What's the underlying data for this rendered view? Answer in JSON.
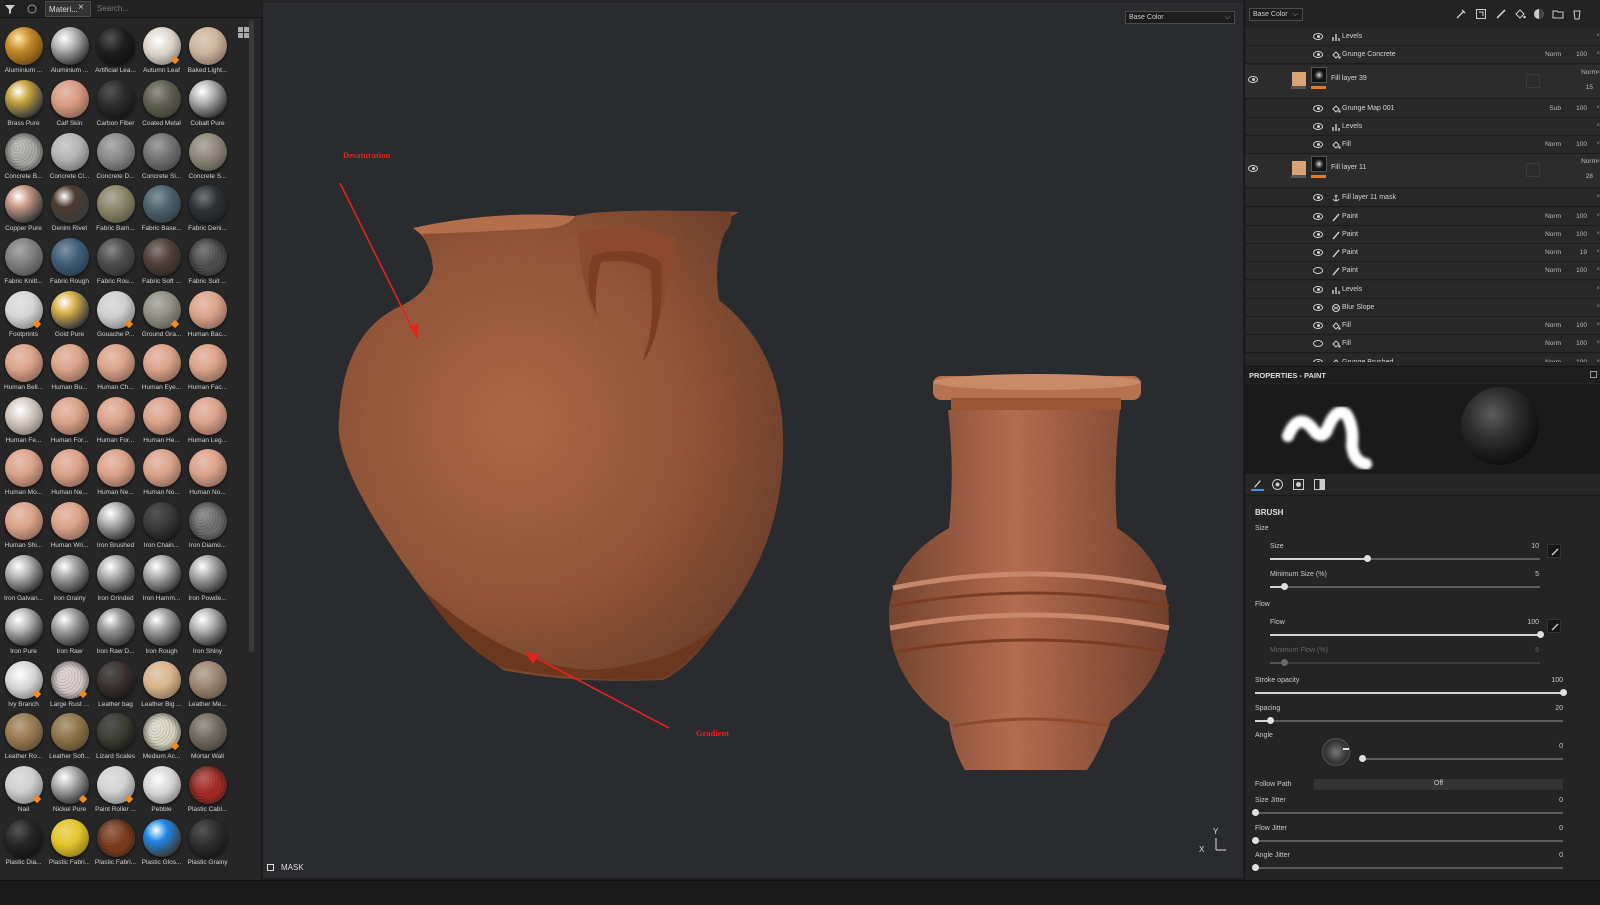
{
  "shelf": {
    "tab_label": "Materi...",
    "search_placeholder": "Search...",
    "materials": [
      {
        "label": "Aluminium ...",
        "color": "#c58a2a",
        "style": "dots"
      },
      {
        "label": "Aluminium ...",
        "color": "#b8b8b8",
        "style": "metal"
      },
      {
        "label": "Artificial Lea...",
        "color": "#1e1e1e",
        "style": "dark"
      },
      {
        "label": "Autumn Leaf",
        "color": "#d8cfc4",
        "style": "leaf",
        "badge": true
      },
      {
        "label": "Baked Light...",
        "color": "#cdb59c",
        "style": "matte"
      },
      {
        "label": "Brass Pure",
        "color": "#c9a53e",
        "style": "metal"
      },
      {
        "label": "Calf Skin",
        "color": "#d79a83",
        "style": "matte"
      },
      {
        "label": "Carbon Fiber",
        "color": "#2c2c2c",
        "style": "dark"
      },
      {
        "label": "Coated Metal",
        "color": "#5f5f4e",
        "style": "matte"
      },
      {
        "label": "Cobalt Pure",
        "color": "#b7b7b7",
        "style": "metal"
      },
      {
        "label": "Concrete B...",
        "color": "#a9a9a5",
        "style": "rough"
      },
      {
        "label": "Concrete Cl...",
        "color": "#b5b5b5",
        "style": "matte"
      },
      {
        "label": "Concrete D...",
        "color": "#8b8b8b",
        "style": "matte"
      },
      {
        "label": "Concrete Si...",
        "color": "#737373",
        "style": "matte"
      },
      {
        "label": "Concrete S...",
        "color": "#8f8778",
        "style": "matte"
      },
      {
        "label": "Copper Pure",
        "color": "#c99a86",
        "style": "metal"
      },
      {
        "label": "Denim Rivet",
        "color": "#4d3c2e",
        "style": "metal"
      },
      {
        "label": "Fabric Bam...",
        "color": "#8a8568",
        "style": "matte"
      },
      {
        "label": "Fabric Base...",
        "color": "#4a606a",
        "style": "matte"
      },
      {
        "label": "Fabric Deni...",
        "color": "#2e3236",
        "style": "matte"
      },
      {
        "label": "Fabric Knitt...",
        "color": "#7f7f7f",
        "style": "matte"
      },
      {
        "label": "Fabric Rough",
        "color": "#3f5d78",
        "style": "matte"
      },
      {
        "label": "Fabric Rou...",
        "color": "#4d4d4d",
        "style": "matte"
      },
      {
        "label": "Fabric Soft ...",
        "color": "#4e3f39",
        "style": "matte"
      },
      {
        "label": "Fabric Suit ...",
        "color": "#4f4f4f",
        "style": "rough"
      },
      {
        "label": "Footprints",
        "color": "#d6d6d6",
        "style": "matte",
        "badge": true
      },
      {
        "label": "Gold Pure",
        "color": "#d9b24a",
        "style": "metal"
      },
      {
        "label": "Gouache P...",
        "color": "#cfcfcf",
        "style": "matte",
        "badge": true
      },
      {
        "label": "Ground Gra...",
        "color": "#8f8f84",
        "style": "matte",
        "badge": true
      },
      {
        "label": "Human Bac...",
        "color": "#dba28a",
        "style": "matte"
      },
      {
        "label": "Human Bell...",
        "color": "#dba28a",
        "style": "matte"
      },
      {
        "label": "Human Bu...",
        "color": "#dba28a",
        "style": "matte"
      },
      {
        "label": "Human Ch...",
        "color": "#dba28a",
        "style": "matte"
      },
      {
        "label": "Human Eye...",
        "color": "#dba28a",
        "style": "matte"
      },
      {
        "label": "Human Fac...",
        "color": "#dba28a",
        "style": "matte"
      },
      {
        "label": "Human Fe...",
        "color": "#c9bdb4",
        "style": "leaf"
      },
      {
        "label": "Human For...",
        "color": "#dba28a",
        "style": "matte"
      },
      {
        "label": "Human For...",
        "color": "#dba28a",
        "style": "matte"
      },
      {
        "label": "Human He...",
        "color": "#dba28a",
        "style": "matte"
      },
      {
        "label": "Human Leg...",
        "color": "#dba28a",
        "style": "matte"
      },
      {
        "label": "Human Mo...",
        "color": "#dba28a",
        "style": "matte"
      },
      {
        "label": "Human Ne...",
        "color": "#dba28a",
        "style": "matte"
      },
      {
        "label": "Human Ne...",
        "color": "#dba28a",
        "style": "matte"
      },
      {
        "label": "Human No...",
        "color": "#dba28a",
        "style": "matte"
      },
      {
        "label": "Human No...",
        "color": "#dba28a",
        "style": "matte"
      },
      {
        "label": "Human Shi...",
        "color": "#dba28a",
        "style": "matte"
      },
      {
        "label": "Human Wri...",
        "color": "#dba28a",
        "style": "matte"
      },
      {
        "label": "Iron Brushed",
        "color": "#b5b5b5",
        "style": "metal"
      },
      {
        "label": "Iron Chain...",
        "color": "#3a3a3a",
        "style": "dark"
      },
      {
        "label": "Iron Diamo...",
        "color": "#6f6f6f",
        "style": "rough"
      },
      {
        "label": "Iron Galvan...",
        "color": "#b9b9b9",
        "style": "metal"
      },
      {
        "label": "Iron Grainy",
        "color": "#a9a9a9",
        "style": "metal"
      },
      {
        "label": "Iron Grinded",
        "color": "#b3b3b3",
        "style": "metal"
      },
      {
        "label": "Iron Hamm...",
        "color": "#b3b3b3",
        "style": "metal"
      },
      {
        "label": "Iron Powde...",
        "color": "#aeaeae",
        "style": "metal"
      },
      {
        "label": "Iron Pure",
        "color": "#bdbdbd",
        "style": "metal"
      },
      {
        "label": "Iron Raw",
        "color": "#a7a7a7",
        "style": "metal"
      },
      {
        "label": "Iron Raw D...",
        "color": "#9c9c9c",
        "style": "metal"
      },
      {
        "label": "Iron Rough",
        "color": "#a8a8a8",
        "style": "metal"
      },
      {
        "label": "Iron Shiny",
        "color": "#b9b9b9",
        "style": "metal"
      },
      {
        "label": "Ivy Branch",
        "color": "#d2d2d2",
        "style": "leaf",
        "badge": true
      },
      {
        "label": "Large Rust ...",
        "color": "#d8c9c9",
        "style": "rough",
        "badge": true
      },
      {
        "label": "Leather bag",
        "color": "#3b3230",
        "style": "dark"
      },
      {
        "label": "Leather Big ...",
        "color": "#d8b48d",
        "style": "matte"
      },
      {
        "label": "Leather Me...",
        "color": "#9c8872",
        "style": "matte"
      },
      {
        "label": "Leather Ro...",
        "color": "#9a7a53",
        "style": "matte"
      },
      {
        "label": "Leather Soft...",
        "color": "#8e7449",
        "style": "matte"
      },
      {
        "label": "Lizard Scales",
        "color": "#3d3f35",
        "style": "dark"
      },
      {
        "label": "Medium Ac...",
        "color": "#d9d5c2",
        "style": "rough",
        "badge": true
      },
      {
        "label": "Mortar Wall",
        "color": "#736b5f",
        "style": "matte"
      },
      {
        "label": "Nail",
        "color": "#cfcfcf",
        "style": "matte",
        "badge": true
      },
      {
        "label": "Nickel Pure",
        "color": "#b3b3b3",
        "style": "metal",
        "badge": true
      },
      {
        "label": "Paint Roller ...",
        "color": "#d2d2d2",
        "style": "matte",
        "badge": true
      },
      {
        "label": "Pebble",
        "color": "#d1d1d1",
        "style": "leaf"
      },
      {
        "label": "Plastic Cabl...",
        "color": "#a62924",
        "style": "rough"
      },
      {
        "label": "Plastic Dia...",
        "color": "#262626",
        "style": "dark"
      },
      {
        "label": "Plastic Fabri...",
        "color": "#e3c42c",
        "style": "matte"
      },
      {
        "label": "Plastic Fabri...",
        "color": "#7e3c1c",
        "style": "rough"
      },
      {
        "label": "Plastic Glos...",
        "color": "#1f88e8",
        "style": "metal"
      },
      {
        "label": "Plastic Grainy",
        "color": "#303030",
        "style": "dark"
      }
    ]
  },
  "viewport": {
    "channel": "Base Color",
    "annotations": {
      "desaturation": "Desaturation",
      "gradient": "Gradient"
    },
    "mask_label": "MASK",
    "axis_y": "Y",
    "axis_x": "X",
    "accent": "#e3231d"
  },
  "layers": {
    "channel": "Base Color",
    "rows": [
      {
        "kind": "effect",
        "icon": "levels-icon",
        "name": "Levels",
        "blend": "",
        "opacity": "",
        "visible": true
      },
      {
        "kind": "effect",
        "icon": "fill-icon",
        "name": "Grunge Concrete",
        "blend": "Norm",
        "opacity": "100",
        "visible": true
      },
      {
        "kind": "layer",
        "name": "Fill layer 39",
        "blend": "Norm",
        "opacity": "15",
        "visible": true
      },
      {
        "kind": "effect",
        "icon": "fill-icon",
        "name": "Grunge Map 001",
        "blend": "Sub",
        "opacity": "100",
        "visible": true
      },
      {
        "kind": "effect",
        "icon": "levels-icon",
        "name": "Levels",
        "blend": "",
        "opacity": "",
        "visible": true
      },
      {
        "kind": "effect",
        "icon": "fill-icon",
        "name": "Fill",
        "blend": "Norm",
        "opacity": "100",
        "visible": true
      },
      {
        "kind": "layer",
        "name": "Fill layer 11",
        "blend": "Norm",
        "opacity": "28",
        "visible": true
      },
      {
        "kind": "effect",
        "icon": "anchor-icon",
        "name": "Fill layer 11 mask",
        "blend": "",
        "opacity": "",
        "visible": true
      },
      {
        "kind": "effect",
        "icon": "brush-icon",
        "name": "Paint",
        "blend": "Norm",
        "opacity": "100",
        "visible": true
      },
      {
        "kind": "effect",
        "icon": "brush-icon",
        "name": "Paint",
        "blend": "Norm",
        "opacity": "100",
        "visible": true
      },
      {
        "kind": "effect",
        "icon": "brush-icon",
        "name": "Paint",
        "blend": "Norm",
        "opacity": "19",
        "visible": true
      },
      {
        "kind": "effect",
        "icon": "brush-icon",
        "name": "Paint",
        "blend": "Norm",
        "opacity": "100",
        "visible": false
      },
      {
        "kind": "effect",
        "icon": "levels-icon",
        "name": "Levels",
        "blend": "",
        "opacity": "",
        "visible": true
      },
      {
        "kind": "effect",
        "icon": "blur-icon",
        "name": "Blur Slope",
        "blend": "",
        "opacity": "",
        "visible": true
      },
      {
        "kind": "effect",
        "icon": "fill-icon",
        "name": "Fill",
        "blend": "Norm",
        "opacity": "100",
        "visible": true
      },
      {
        "kind": "effect",
        "icon": "fill-icon",
        "name": "Fill",
        "blend": "Norm",
        "opacity": "100",
        "visible": false
      },
      {
        "kind": "effect",
        "icon": "fill-icon",
        "name": "Grunge Brushed",
        "blend": "Norm",
        "opacity": "100",
        "visible": true
      }
    ]
  },
  "properties": {
    "title": "PROPERTIES - PAINT",
    "section": "BRUSH",
    "groups": {
      "size": "Size",
      "flow": "Flow",
      "angle": "Angle"
    },
    "params": {
      "size": {
        "label": "Size",
        "value": "10",
        "fraction": 0.36
      },
      "min_size": {
        "label": "Minimum Size (%)",
        "value": "5",
        "fraction": 0.05
      },
      "flow": {
        "label": "Flow",
        "value": "100",
        "fraction": 1.0
      },
      "min_flow": {
        "label": "Minimum Flow (%)",
        "value": "5",
        "fraction": 0.05
      },
      "stroke_opacity": {
        "label": "Stroke opacity",
        "value": "100",
        "fraction": 1.0
      },
      "spacing": {
        "label": "Spacing",
        "value": "20",
        "fraction": 0.05
      },
      "angle": {
        "value": "0",
        "fraction": 0.0
      },
      "follow_path": {
        "label": "Follow Path",
        "value": "Off"
      },
      "size_jitter": {
        "label": "Size Jitter",
        "value": "0",
        "fraction": 0.0
      },
      "flow_jitter": {
        "label": "Flow Jitter",
        "value": "0",
        "fraction": 0.0
      },
      "angle_jitter": {
        "label": "Angle Jitter",
        "value": "0",
        "fraction": 0.0
      }
    }
  }
}
